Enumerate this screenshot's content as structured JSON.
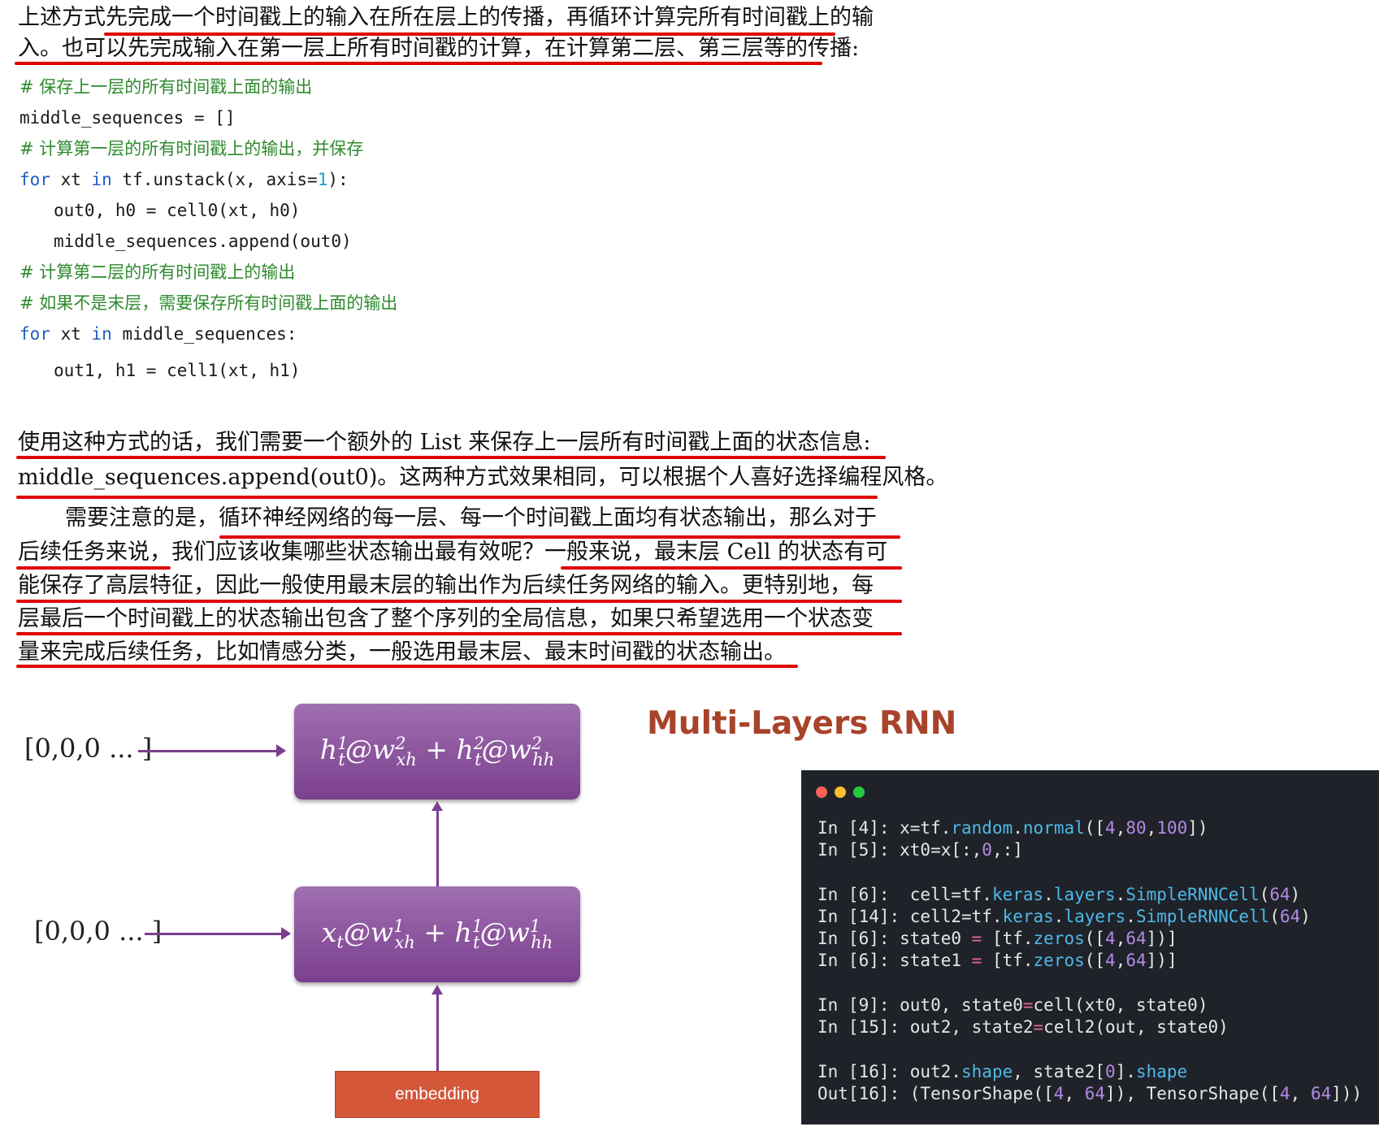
{
  "paragraph1": {
    "line1": "上述方式先完成一个时间戳上的输入在所在层上的传播，再循环计算完所有时间戳上的输",
    "line2": "入。也可以先完成输入在第一层上所有时间戳的计算，在计算第二层、第三层等的传播:"
  },
  "code": {
    "l1": "# 保存上一层的所有时间戳上面的输出",
    "l2": "middle_sequences = []",
    "l3": "# 计算第一层的所有时间戳上的输出，并保存",
    "l4_kw1": "for",
    "l4_a": " xt ",
    "l4_kw2": "in",
    "l4_b": " tf.unstack(x, axis=",
    "l4_num": "1",
    "l4_c": "):",
    "l5": "out0, h0 = cell0(xt, h0)",
    "l6": "middle_sequences.append(out0)",
    "l7": "# 计算第二层的所有时间戳上的输出",
    "l8": "# 如果不是末层，需要保存所有时间戳上面的输出",
    "l9_kw1": "for",
    "l9_a": " xt ",
    "l9_kw2": "in",
    "l9_b": " middle_sequences:",
    "l10": "out1, h1 = cell1(xt, h1)"
  },
  "paragraph2": {
    "line1": "使用这种方式的话，我们需要一个额外的 List 来保存上一层所有时间戳上面的状态信息:",
    "line2": "middle_sequences.append(out0)。这两种方式效果相同，可以根据个人喜好选择编程风格。"
  },
  "paragraph3": {
    "line1": "需要注意的是，循环神经网络的每一层、每一个时间戳上面均有状态输出，那么对于",
    "line2": "后续任务来说，我们应该收集哪些状态输出最有效呢？一般来说，最末层 Cell 的状态有可",
    "line3": "能保存了高层特征，因此一般使用最末层的输出作为后续任务网络的输入。更特别地，每",
    "line4": "层最后一个时间戳上的状态输出包含了整个序列的全局信息，如果只希望选用一个状态变",
    "line5": "量来完成后续任务，比如情感分类，一般选用最末层、最末时间戳的状态输出。"
  },
  "diagram": {
    "top_input": "[0,0,0 ... ]",
    "bottom_input": "[0,0,0 ... ]",
    "top_box": {
      "a": "h",
      "a_sup": "1",
      "a_sub": "t",
      "b": "@w",
      "b_sup": "2",
      "b_sub": "xh",
      "plus": " + ",
      "c": "h",
      "c_sup": "2",
      "c_sub": "t",
      "d": "@w",
      "d_sup": "2",
      "d_sub": "hh"
    },
    "bottom_box": {
      "a": "x",
      "a_sub": "t",
      "b": "@w",
      "b_sup": "1",
      "b_sub": "xh",
      "plus": " + ",
      "c": "h",
      "c_sup": "1",
      "c_sub": "t",
      "d": "@w",
      "d_sup": "1",
      "d_sub": "hh"
    },
    "embedding_label": "embedding",
    "colors": {
      "box": "#7b3f8e",
      "embedding": "#d4573a"
    }
  },
  "slide_title": "Multi-Layers RNN",
  "terminal": {
    "dot_colors": [
      "#ff5f56",
      "#ffbd2e",
      "#27c93f"
    ],
    "lines": [
      {
        "p": "In [4]: x=tf.",
        "a1": "random",
        "m": ".",
        "a2": "normal",
        "r1": "([",
        "n1": "4",
        "r2": ",",
        "n2": "80",
        "r3": ",",
        "n3": "100",
        "r4": "])"
      },
      {
        "p": "In [5]: xt0=x[:,",
        "n1": "0",
        "r1": ",:]"
      },
      {
        "p": "In [6]:  cell=tf.",
        "a1": "keras",
        "m1": ".",
        "a2": "layers",
        "m2": ".",
        "a3": "SimpleRNNCell",
        "r1": "(",
        "n1": "64",
        "r2": ")"
      },
      {
        "p": "In [14]: cell2=tf.",
        "a1": "keras",
        "m1": ".",
        "a2": "layers",
        "m2": ".",
        "a3": "SimpleRNNCell",
        "r1": "(",
        "n1": "64",
        "r2": ")"
      },
      {
        "p": "In [6]: state0 ",
        "op": "=",
        "r0": " [tf.",
        "a1": "zeros",
        "r1": "([",
        "n1": "4",
        "r2": ",",
        "n2": "64",
        "r3": "])]"
      },
      {
        "p": "In [6]: state1 ",
        "op": "=",
        "r0": " [tf.",
        "a1": "zeros",
        "r1": "([",
        "n1": "4",
        "r2": ",",
        "n2": "64",
        "r3": "])]"
      },
      {
        "p": "In [9]: out0, state0",
        "op": "=",
        "r0": "cell(xt0, state0)"
      },
      {
        "p": "In [15]: out2, state2",
        "op": "=",
        "r0": "cell2(out, state0)"
      },
      {
        "p": "In [16]: out2.",
        "a1": "shape",
        "r1": ", state2[",
        "n1": "0",
        "r2": "].",
        "a2": "shape"
      },
      {
        "p": "Out[16]: (TensorShape([",
        "n1": "4",
        "r1": ", ",
        "n2": "64",
        "r2": "]), TensorShape([",
        "n3": "4",
        "r3": ", ",
        "n4": "64",
        "r4": "]))"
      }
    ]
  }
}
